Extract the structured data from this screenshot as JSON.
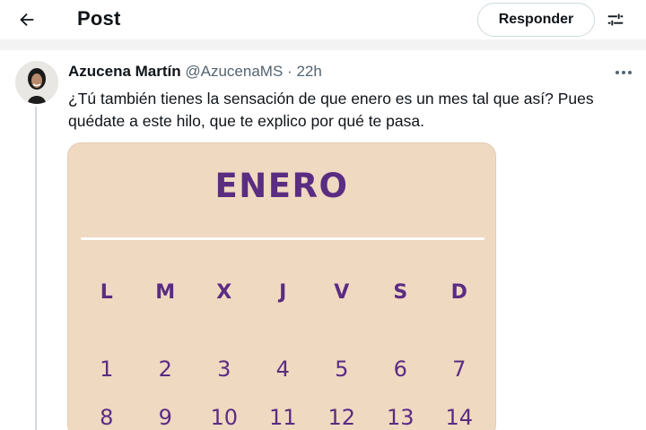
{
  "header": {
    "title": "Post",
    "reply_label": "Responder",
    "back_icon": "arrow-left-icon",
    "settings_icon": "sliders-icon"
  },
  "tweet": {
    "author": "Azucena Martín",
    "handle": "@AzucenaMS",
    "separator": "·",
    "time": "22h",
    "text": "¿Tú también tienes la sensación de que enero es un mes tal que así? Pues quédate a este hilo, que te explico por qué te pasa.",
    "more_icon": "more-horizontal-icon"
  },
  "image": {
    "month": "ENERO",
    "weekdays": [
      "L",
      "M",
      "X",
      "J",
      "V",
      "S",
      "D"
    ],
    "weeks": [
      [
        "1",
        "2",
        "3",
        "4",
        "5",
        "6",
        "7"
      ],
      [
        "8",
        "9",
        "10",
        "11",
        "12",
        "13",
        "14"
      ]
    ]
  },
  "colors": {
    "text": "#0f1419",
    "secondary": "#536471",
    "calendar_bg": "#efd9c1",
    "calendar_ink": "#5a2c82"
  }
}
